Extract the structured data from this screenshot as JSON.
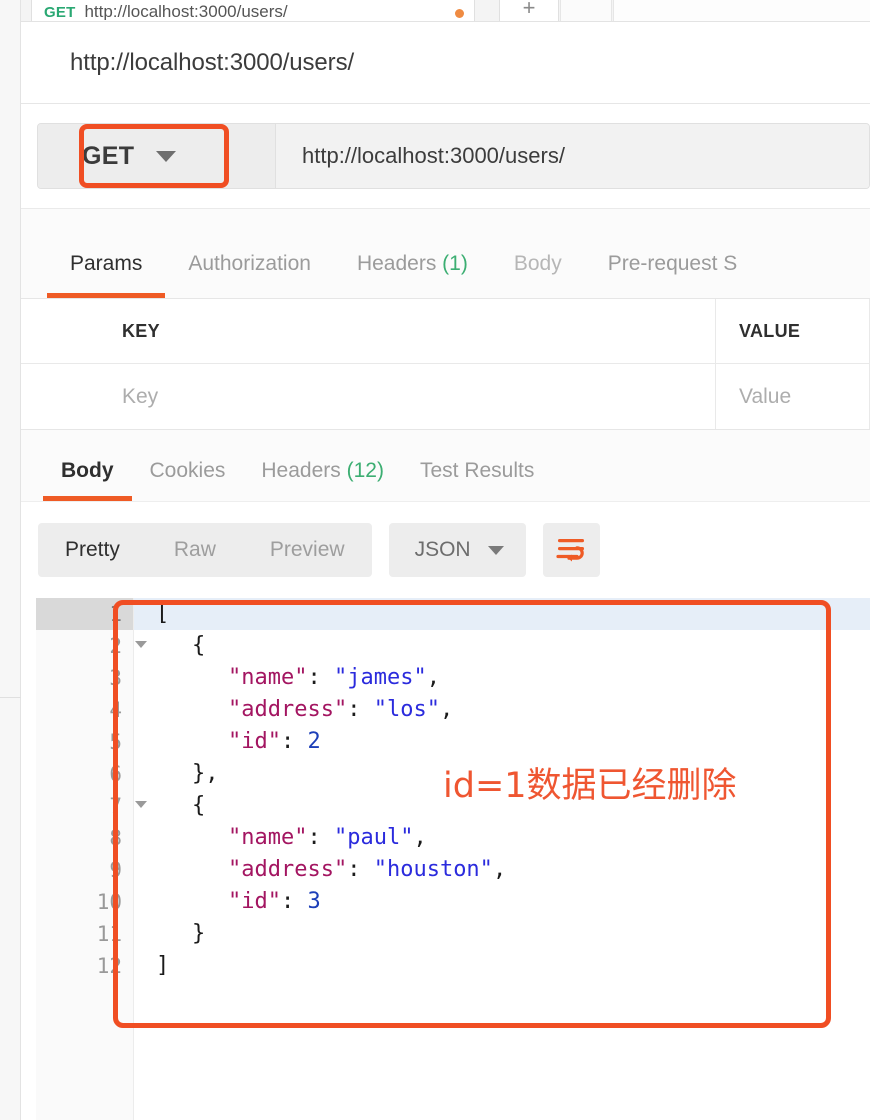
{
  "app": "postman",
  "colors": {
    "accent": "#ef5b25",
    "annotation": "#f04e23",
    "method_get": "#2aa873",
    "count_green": "#3cae72",
    "json_key": "#a31561",
    "json_string": "#2b2bdd",
    "json_number": "#1d3fb8"
  },
  "tabbar": {
    "active_tab": {
      "method": "GET",
      "title": "http://localhost:3000/users/",
      "unsaved_dot": "●"
    },
    "new_tab_label": "+"
  },
  "request": {
    "title": "http://localhost:3000/users/",
    "method": "GET",
    "url": "http://localhost:3000/users/"
  },
  "request_tabs": [
    {
      "label": "Params",
      "count": "",
      "active": true,
      "muted": false
    },
    {
      "label": "Authorization",
      "count": "",
      "active": false,
      "muted": false
    },
    {
      "label": "Headers",
      "count": "(1)",
      "active": false,
      "muted": false
    },
    {
      "label": "Body",
      "count": "",
      "active": false,
      "muted": true
    },
    {
      "label": "Pre-request S",
      "count": "",
      "active": false,
      "muted": false
    }
  ],
  "params_table": {
    "headers": {
      "key": "KEY",
      "value": "VALUE"
    },
    "placeholder_row": {
      "key": "Key",
      "value": "Value"
    }
  },
  "response_tabs": [
    {
      "label": "Body",
      "count": "",
      "active": true
    },
    {
      "label": "Cookies",
      "count": "",
      "active": false
    },
    {
      "label": "Headers",
      "count": "(12)",
      "active": false
    },
    {
      "label": "Test Results",
      "count": "",
      "active": false
    }
  ],
  "body_toolbar": {
    "views": [
      {
        "label": "Pretty",
        "active": true
      },
      {
        "label": "Raw",
        "active": false
      },
      {
        "label": "Preview",
        "active": false
      }
    ],
    "format": "JSON",
    "wrap_icon": "word-wrap-icon"
  },
  "code": {
    "line_numbers": [
      "1",
      "2",
      "3",
      "4",
      "5",
      "6",
      "7",
      "8",
      "9",
      "10",
      "11",
      "12"
    ],
    "fold_lines": [
      "1",
      "2",
      "7"
    ],
    "highlighted_line": "1",
    "lines": [
      {
        "n": "1",
        "indent": 0,
        "tokens": [
          {
            "t": "p",
            "v": "["
          }
        ]
      },
      {
        "n": "2",
        "indent": 1,
        "tokens": [
          {
            "t": "p",
            "v": "{"
          }
        ]
      },
      {
        "n": "3",
        "indent": 2,
        "tokens": [
          {
            "t": "k",
            "v": "\"name\""
          },
          {
            "t": "p",
            "v": ": "
          },
          {
            "t": "s",
            "v": "\"james\""
          },
          {
            "t": "p",
            "v": ","
          }
        ]
      },
      {
        "n": "4",
        "indent": 2,
        "tokens": [
          {
            "t": "k",
            "v": "\"address\""
          },
          {
            "t": "p",
            "v": ": "
          },
          {
            "t": "s",
            "v": "\"los\""
          },
          {
            "t": "p",
            "v": ","
          }
        ]
      },
      {
        "n": "5",
        "indent": 2,
        "tokens": [
          {
            "t": "k",
            "v": "\"id\""
          },
          {
            "t": "p",
            "v": ": "
          },
          {
            "t": "n",
            "v": "2"
          }
        ]
      },
      {
        "n": "6",
        "indent": 1,
        "tokens": [
          {
            "t": "p",
            "v": "},"
          }
        ]
      },
      {
        "n": "7",
        "indent": 1,
        "tokens": [
          {
            "t": "p",
            "v": "{"
          }
        ]
      },
      {
        "n": "8",
        "indent": 2,
        "tokens": [
          {
            "t": "k",
            "v": "\"name\""
          },
          {
            "t": "p",
            "v": ": "
          },
          {
            "t": "s",
            "v": "\"paul\""
          },
          {
            "t": "p",
            "v": ","
          }
        ]
      },
      {
        "n": "9",
        "indent": 2,
        "tokens": [
          {
            "t": "k",
            "v": "\"address\""
          },
          {
            "t": "p",
            "v": ": "
          },
          {
            "t": "s",
            "v": "\"houston\""
          },
          {
            "t": "p",
            "v": ","
          }
        ]
      },
      {
        "n": "10",
        "indent": 2,
        "tokens": [
          {
            "t": "k",
            "v": "\"id\""
          },
          {
            "t": "p",
            "v": ": "
          },
          {
            "t": "n",
            "v": "3"
          }
        ]
      },
      {
        "n": "11",
        "indent": 1,
        "tokens": [
          {
            "t": "p",
            "v": "}"
          }
        ]
      },
      {
        "n": "12",
        "indent": 0,
        "tokens": [
          {
            "t": "p",
            "v": "]"
          }
        ]
      }
    ],
    "response_json": [
      {
        "name": "james",
        "address": "los",
        "id": 2
      },
      {
        "name": "paul",
        "address": "houston",
        "id": 3
      }
    ]
  },
  "annotations": {
    "get_box": "highlight-around-get-method",
    "body_box": "highlight-around-response-body",
    "note_text": "id=1数据已经删除"
  }
}
